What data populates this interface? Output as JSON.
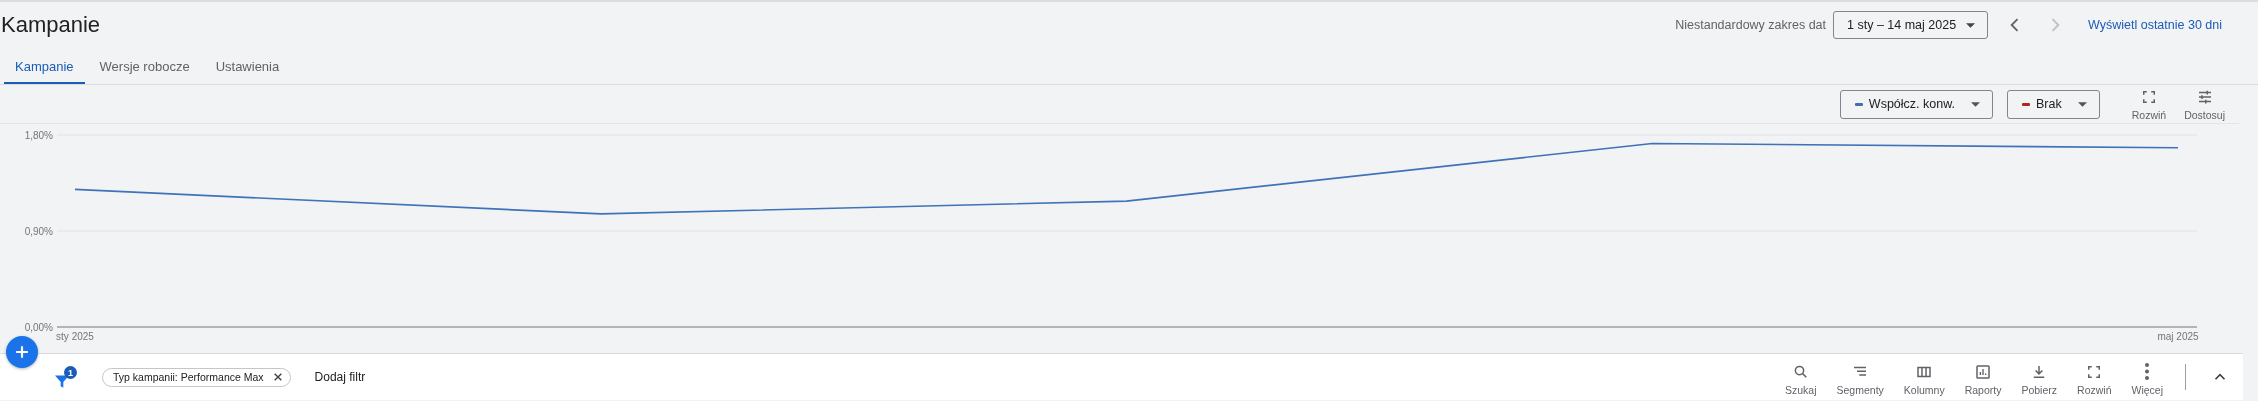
{
  "page_title": "Kampanie",
  "date_range": {
    "label": "Niestandardowy zakres dat",
    "value": "1 sty – 14 maj 2025",
    "link": "Wyświetl ostatnie 30 dni",
    "prev_disabled": false,
    "next_disabled": true
  },
  "tabs": [
    {
      "label": "Kampanie",
      "selected": true
    },
    {
      "label": "Wersje robocze",
      "selected": false
    },
    {
      "label": "Ustawienia",
      "selected": false
    }
  ],
  "chart_controls": {
    "metrics": [
      {
        "label": "Współcz. konw.",
        "color": "#3f6fb5"
      },
      {
        "label": "Brak",
        "color": "#b3261e"
      }
    ],
    "actions": [
      {
        "label": "Rozwiń",
        "kind": "expand"
      },
      {
        "label": "Dostosuj",
        "kind": "tune"
      }
    ]
  },
  "chart": {
    "chart_data": {
      "type": "line",
      "categories": [
        "sty 2025",
        null,
        null,
        null,
        "maj 2025"
      ],
      "series": [
        {
          "color": "#3f72b8",
          "values": [
            1.29,
            1.06,
            1.18,
            1.72,
            1.68
          ]
        }
      ],
      "ylim": [
        0,
        1.8
      ],
      "yticks": [
        {
          "value": 0,
          "label": "0,00%"
        },
        {
          "value": 0.9,
          "label": "0,90%"
        },
        {
          "value": 1.8,
          "label": "1,80%"
        }
      ]
    }
  },
  "filter_bar": {
    "filter_count": "1",
    "chips": [
      {
        "label": "Typ kampanii: Performance Max"
      }
    ],
    "add_filter": "Dodaj filtr"
  },
  "toolbar": [
    {
      "label": "Szukaj",
      "kind": "search"
    },
    {
      "label": "Segmenty",
      "kind": "segments"
    },
    {
      "label": "Kolumny",
      "kind": "columns"
    },
    {
      "label": "Raporty",
      "kind": "reports"
    },
    {
      "label": "Pobierz",
      "kind": "download"
    },
    {
      "label": "Rozwiń",
      "kind": "expand"
    },
    {
      "label": "Więcej",
      "kind": "more"
    }
  ]
}
